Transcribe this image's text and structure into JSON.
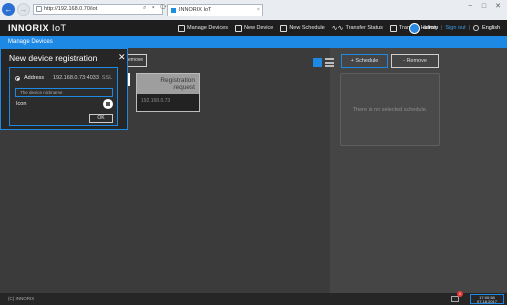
{
  "browser": {
    "address": "http://192.168.0.70/iot",
    "tab_title": "INNORIX IoT",
    "addr_tools": "⌕ ▾ ⟳",
    "controls": {
      "minimize": "−",
      "maximize": "□",
      "close": "✕"
    },
    "back_glyph": "←",
    "forward_glyph": "→",
    "tab_close_glyph": "×"
  },
  "app": {
    "logo": "INNORIX",
    "logo_suffix": "IoT",
    "menu": [
      {
        "label": "Manage Devices",
        "icon": "checkbox-icon"
      },
      {
        "label": "New Device",
        "icon": "monitor-icon"
      },
      {
        "label": "New Schedule",
        "icon": "calendar-icon"
      },
      {
        "label": "Transfer Status",
        "icon": "wave-icon",
        "glyph": "∿∿"
      },
      {
        "label": "Transfer History",
        "icon": "document-icon"
      }
    ],
    "user": {
      "name": "admin",
      "sign_out": "Sign out",
      "separator": "|",
      "language": "English"
    }
  },
  "page": {
    "section_title": "Manage Devices",
    "remove_small_label": "emove",
    "registration_card": {
      "title_line1": "Registration",
      "title_line2": "request",
      "ip": "192.168.0.73"
    },
    "schedule_button": "+ Schedule",
    "remove_button": "- Remove",
    "schedule_empty": "There is no selected schedule."
  },
  "modal": {
    "title": "New device registration",
    "close_glyph": "✕",
    "address_label": "Address",
    "address_value": "192.168.0.73:4033",
    "ssl_label": "SSL",
    "nickname_placeholder": "The device nickname",
    "icon_label": "Icon",
    "ok_label": "OK"
  },
  "footer": {
    "copyright": "(C) INNORIX",
    "mail_count": "1",
    "time": "17:00:58",
    "date": "07.18.2017"
  },
  "colors": {
    "accent": "#1e88e5",
    "badge": "#e53935",
    "background": "#3a3a3a"
  }
}
